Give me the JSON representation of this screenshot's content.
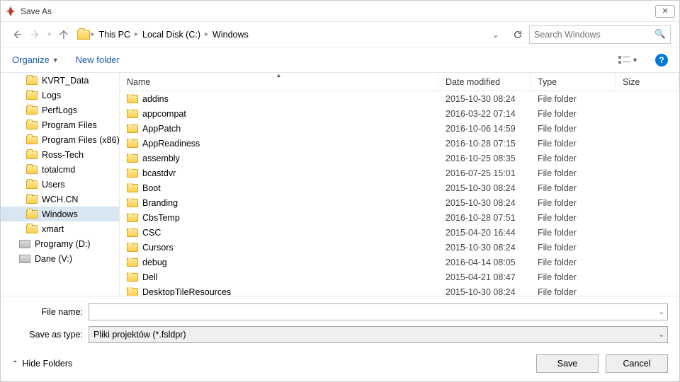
{
  "title": "Save As",
  "breadcrumb": {
    "p0": "This PC",
    "p1": "Local Disk (C:)",
    "p2": "Windows"
  },
  "search_placeholder": "Search Windows",
  "toolbar": {
    "organize": "Organize",
    "newfolder": "New folder"
  },
  "columns": {
    "name": "Name",
    "date": "Date modified",
    "type": "Type",
    "size": "Size"
  },
  "tree": {
    "i0": "KVRT_Data",
    "i1": "Logs",
    "i2": "PerfLogs",
    "i3": "Program Files",
    "i4": "Program Files (x86)",
    "i5": "Ross-Tech",
    "i6": "totalcmd",
    "i7": "Users",
    "i8": "WCH.CN",
    "i9": "Windows",
    "i10": "xmart",
    "i11": "Programy (D:)",
    "i12": "Dane (V:)"
  },
  "rows": [
    {
      "name": "addins",
      "date": "2015-10-30 08:24",
      "type": "File folder"
    },
    {
      "name": "appcompat",
      "date": "2016-03-22 07:14",
      "type": "File folder"
    },
    {
      "name": "AppPatch",
      "date": "2016-10-06 14:59",
      "type": "File folder"
    },
    {
      "name": "AppReadiness",
      "date": "2016-10-28 07:15",
      "type": "File folder"
    },
    {
      "name": "assembly",
      "date": "2016-10-25 08:35",
      "type": "File folder"
    },
    {
      "name": "bcastdvr",
      "date": "2016-07-25 15:01",
      "type": "File folder"
    },
    {
      "name": "Boot",
      "date": "2015-10-30 08:24",
      "type": "File folder"
    },
    {
      "name": "Branding",
      "date": "2015-10-30 08:24",
      "type": "File folder"
    },
    {
      "name": "CbsTemp",
      "date": "2016-10-28 07:51",
      "type": "File folder"
    },
    {
      "name": "CSC",
      "date": "2015-04-20 16:44",
      "type": "File folder"
    },
    {
      "name": "Cursors",
      "date": "2015-10-30 08:24",
      "type": "File folder"
    },
    {
      "name": "debug",
      "date": "2016-04-14 08:05",
      "type": "File folder"
    },
    {
      "name": "Dell",
      "date": "2015-04-21 08:47",
      "type": "File folder"
    },
    {
      "name": "DesktopTileResources",
      "date": "2015-10-30 08:24",
      "type": "File folder"
    }
  ],
  "form": {
    "filename_label": "File name:",
    "filename_value": "",
    "type_label": "Save as type:",
    "type_value": "Pliki projektów (*.fsldpr)"
  },
  "buttons": {
    "hide": "Hide Folders",
    "save": "Save",
    "cancel": "Cancel"
  }
}
